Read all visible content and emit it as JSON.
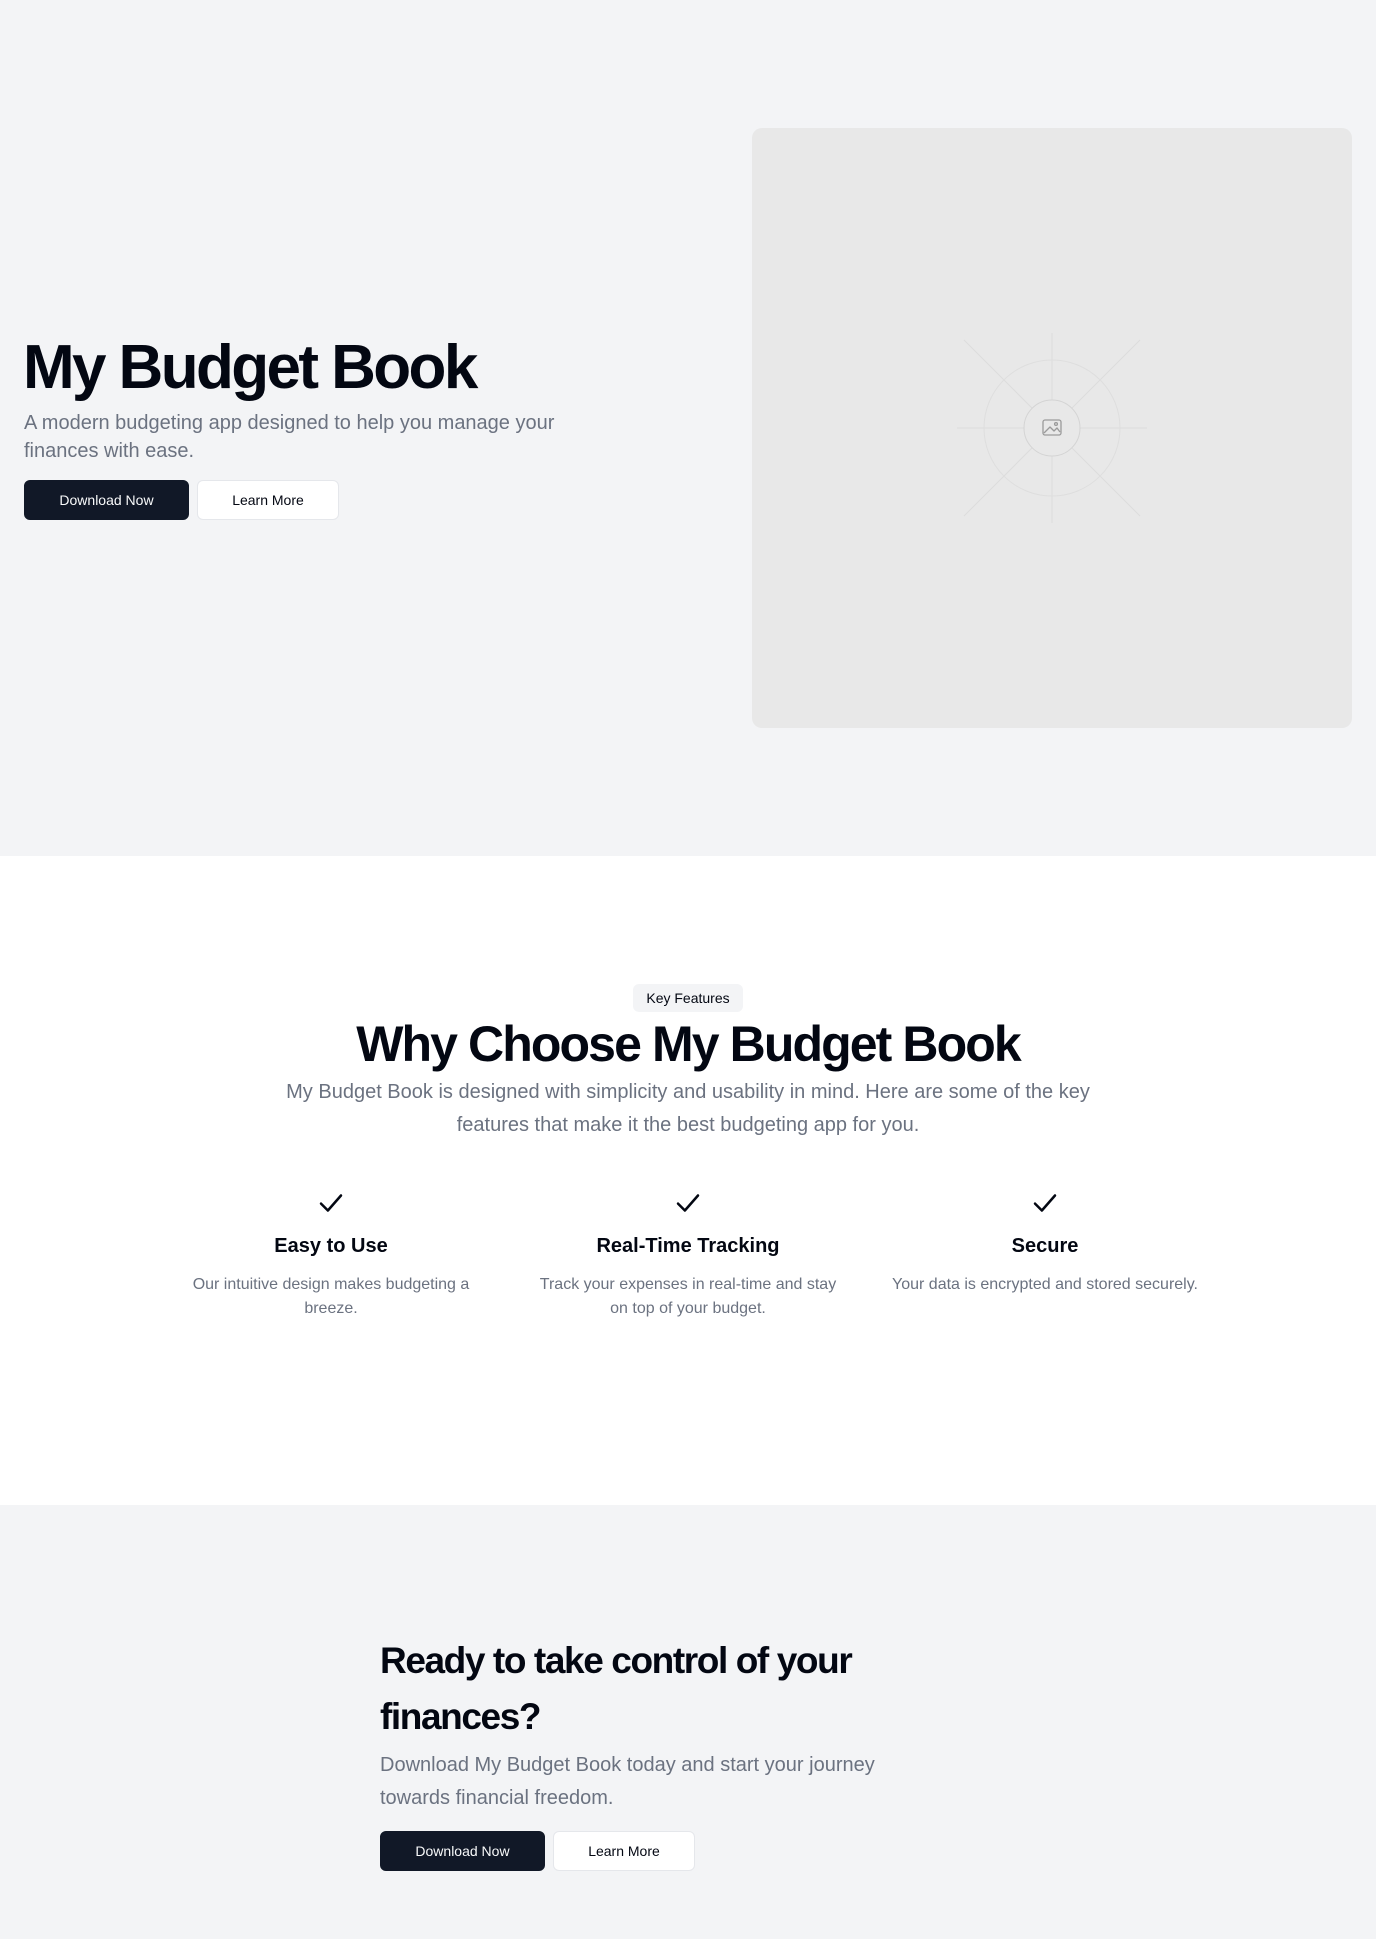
{
  "hero": {
    "title": "My Budget Book",
    "subtitle": "A modern budgeting app designed to help you manage your finances with ease.",
    "primary_button": "Download Now",
    "secondary_button": "Learn More",
    "image_icon": "image-placeholder-icon"
  },
  "features": {
    "badge": "Key Features",
    "title": "Why Choose My Budget Book",
    "subtitle": "My Budget Book is designed with simplicity and usability in mind. Here are some of the key features that make it the best budgeting app for you.",
    "items": [
      {
        "icon": "check-icon",
        "title": "Easy to Use",
        "description": "Our intuitive design makes budgeting a breeze."
      },
      {
        "icon": "check-icon",
        "title": "Real-Time Tracking",
        "description": "Track your expenses in real-time and stay on top of your budget."
      },
      {
        "icon": "check-icon",
        "title": "Secure",
        "description": "Your data is encrypted and stored securely."
      }
    ]
  },
  "cta": {
    "title": "Ready to take control of your finances?",
    "subtitle": "Download My Budget Book today and start your journey towards financial freedom.",
    "primary_button": "Download Now",
    "secondary_button": "Learn More"
  },
  "colors": {
    "page_background": "#f3f4f6",
    "section_white": "#ffffff",
    "primary_button": "#111827",
    "muted_text": "#6b7280",
    "heading_text": "#030712"
  }
}
